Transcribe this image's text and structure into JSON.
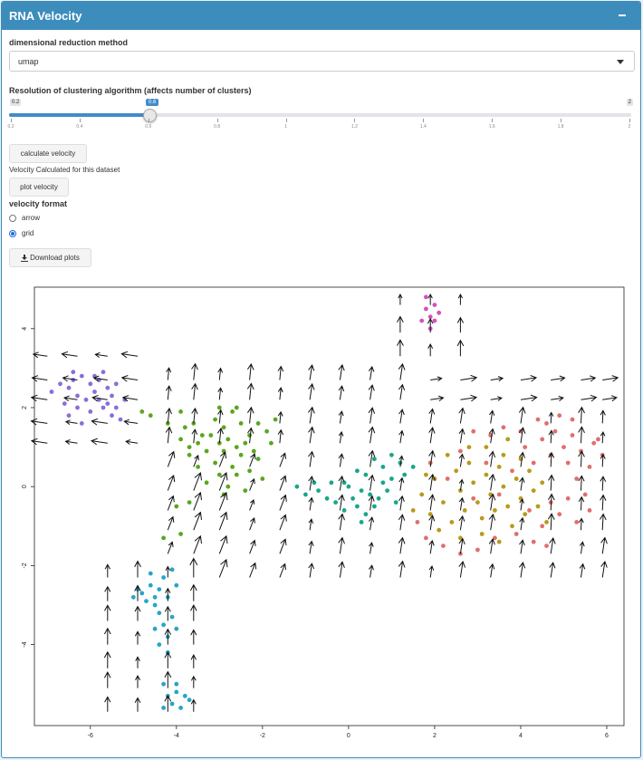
{
  "panel": {
    "title": "RNA Velocity"
  },
  "reduction": {
    "label": "dimensional reduction method",
    "selected": "umap"
  },
  "resolution": {
    "label": "Resolution of clustering algorithm (affects number of clusters)",
    "min_label": "0.2",
    "max_label": "2",
    "value_label": "0.6",
    "min": 0.2,
    "max": 2,
    "value": 0.6,
    "ticks": [
      "0.2",
      "0.4",
      "0.6",
      "0.8",
      "1",
      "1.2",
      "1.4",
      "1.6",
      "1.8",
      "2"
    ]
  },
  "buttons": {
    "calculate": "calculate velocity",
    "plot": "plot velocity",
    "download": "Download plots"
  },
  "status": "Velocity Calculated for this dataset",
  "format": {
    "label": "velocity format",
    "options": [
      {
        "label": "arrow",
        "checked": false
      },
      {
        "label": "grid",
        "checked": true
      }
    ]
  },
  "chart_data": {
    "type": "scatter",
    "title": "",
    "xlabel": "",
    "ylabel": "",
    "xlim": [
      -7.3,
      6.4
    ],
    "ylim": [
      -6.05,
      5.05
    ],
    "x_ticks": [
      -6,
      -4,
      -2,
      0,
      2,
      4,
      6
    ],
    "y_ticks": [
      -4,
      -2,
      0,
      2,
      4
    ],
    "overlay": "velocity grid arrows",
    "colors": [
      "#8b6ddb",
      "#5ba61e",
      "#1aa58a",
      "#b89a1c",
      "#e06f6c",
      "#26a6c4",
      "#d54fbf"
    ],
    "series": [
      {
        "color": "#8b6ddb",
        "points": [
          [
            -6.9,
            2.4
          ],
          [
            -6.7,
            2.6
          ],
          [
            -6.5,
            2.5
          ],
          [
            -6.4,
            2.7
          ],
          [
            -6.3,
            2.3
          ],
          [
            -6.2,
            2.8
          ],
          [
            -6.0,
            2.6
          ],
          [
            -5.9,
            2.4
          ],
          [
            -5.8,
            2.7
          ],
          [
            -5.7,
            2.9
          ],
          [
            -5.6,
            2.5
          ],
          [
            -5.5,
            2.3
          ],
          [
            -5.6,
            2.1
          ],
          [
            -5.8,
            2.2
          ],
          [
            -6.1,
            2.2
          ],
          [
            -6.3,
            2.0
          ],
          [
            -6.5,
            1.8
          ],
          [
            -6.6,
            2.1
          ],
          [
            -6.0,
            1.9
          ],
          [
            -5.7,
            2.0
          ],
          [
            -5.4,
            2.0
          ],
          [
            -5.3,
            1.7
          ],
          [
            -5.2,
            2.2
          ],
          [
            -5.4,
            2.6
          ],
          [
            -6.2,
            1.6
          ],
          [
            -5.9,
            2.8
          ],
          [
            -6.4,
            2.9
          ],
          [
            -5.5,
            1.8
          ]
        ]
      },
      {
        "color": "#5ba61e",
        "points": [
          [
            -4.8,
            1.9
          ],
          [
            -4.6,
            1.8
          ],
          [
            -4.2,
            1.6
          ],
          [
            -3.9,
            1.9
          ],
          [
            -3.6,
            1.6
          ],
          [
            -3.4,
            1.3
          ],
          [
            -3.1,
            1.7
          ],
          [
            -2.9,
            1.5
          ],
          [
            -2.7,
            1.9
          ],
          [
            -2.5,
            1.6
          ],
          [
            -2.3,
            1.3
          ],
          [
            -2.1,
            1.6
          ],
          [
            -1.9,
            1.4
          ],
          [
            -1.8,
            1.1
          ],
          [
            -1.7,
            1.7
          ],
          [
            -3.7,
            0.8
          ],
          [
            -3.5,
            0.5
          ],
          [
            -3.3,
            0.9
          ],
          [
            -3.1,
            0.6
          ],
          [
            -2.9,
            0.9
          ],
          [
            -2.7,
            0.5
          ],
          [
            -2.5,
            0.8
          ],
          [
            -2.3,
            0.4
          ],
          [
            -2.1,
            0.7
          ],
          [
            -2.0,
            0.2
          ],
          [
            -3.9,
            1.2
          ],
          [
            -3.7,
            1.0
          ],
          [
            -3.5,
            1.1
          ],
          [
            -3.2,
            1.3
          ],
          [
            -3.0,
            1.1
          ],
          [
            -2.8,
            1.2
          ],
          [
            -2.6,
            1.0
          ],
          [
            -2.4,
            1.1
          ],
          [
            -2.2,
            0.9
          ],
          [
            -3.0,
            0.3
          ],
          [
            -2.8,
            0.0
          ],
          [
            -2.6,
            0.3
          ],
          [
            -3.3,
            0.1
          ],
          [
            -2.9,
            -0.2
          ],
          [
            -2.4,
            -0.1
          ],
          [
            -3.8,
            1.5
          ],
          [
            -2.6,
            2.0
          ],
          [
            -3.0,
            2.0
          ],
          [
            -4.0,
            -0.5
          ],
          [
            -3.7,
            -0.4
          ],
          [
            -4.3,
            -1.3
          ],
          [
            -3.9,
            -1.2
          ]
        ]
      },
      {
        "color": "#1aa58a",
        "points": [
          [
            -1.2,
            0.0
          ],
          [
            -1.0,
            -0.2
          ],
          [
            -0.8,
            0.1
          ],
          [
            -0.7,
            -0.1
          ],
          [
            -0.5,
            -0.3
          ],
          [
            -0.4,
            0.1
          ],
          [
            -0.3,
            -0.4
          ],
          [
            -0.1,
            -0.6
          ],
          [
            0.0,
            0.0
          ],
          [
            0.1,
            -0.3
          ],
          [
            0.2,
            -0.5
          ],
          [
            0.3,
            -0.1
          ],
          [
            0.4,
            -0.7
          ],
          [
            0.5,
            -0.2
          ],
          [
            0.6,
            -0.5
          ],
          [
            0.7,
            -0.3
          ],
          [
            0.8,
            0.1
          ],
          [
            0.9,
            -0.1
          ],
          [
            1.0,
            0.2
          ],
          [
            1.1,
            -0.4
          ],
          [
            1.2,
            0.6
          ],
          [
            1.0,
            0.8
          ],
          [
            0.8,
            0.5
          ],
          [
            0.6,
            0.7
          ],
          [
            0.4,
            0.3
          ],
          [
            0.2,
            0.4
          ],
          [
            -0.1,
            0.1
          ],
          [
            0.3,
            -0.9
          ],
          [
            1.3,
            0.3
          ],
          [
            1.5,
            0.5
          ]
        ]
      },
      {
        "color": "#b89a1c",
        "points": [
          [
            1.5,
            -0.6
          ],
          [
            1.7,
            -0.2
          ],
          [
            1.9,
            -0.7
          ],
          [
            2.0,
            0.2
          ],
          [
            2.2,
            -0.4
          ],
          [
            2.4,
            -0.9
          ],
          [
            2.5,
            0.4
          ],
          [
            2.6,
            -0.1
          ],
          [
            2.7,
            -0.6
          ],
          [
            2.8,
            0.6
          ],
          [
            2.9,
            0.1
          ],
          [
            3.0,
            -0.4
          ],
          [
            3.1,
            -0.8
          ],
          [
            3.2,
            0.3
          ],
          [
            3.3,
            -0.2
          ],
          [
            3.4,
            -0.6
          ],
          [
            3.5,
            0.5
          ],
          [
            3.6,
            0.0
          ],
          [
            3.7,
            -0.5
          ],
          [
            3.8,
            -1.0
          ],
          [
            3.9,
            0.2
          ],
          [
            4.0,
            -0.3
          ],
          [
            4.1,
            -0.7
          ],
          [
            4.2,
            0.4
          ],
          [
            4.3,
            -0.1
          ],
          [
            4.4,
            -0.5
          ],
          [
            4.5,
            0.1
          ],
          [
            2.3,
            0.8
          ],
          [
            2.8,
            1.0
          ],
          [
            3.2,
            1.0
          ],
          [
            3.6,
            0.8
          ],
          [
            4.0,
            0.7
          ],
          [
            2.1,
            -1.1
          ],
          [
            2.6,
            -1.3
          ],
          [
            3.1,
            -1.2
          ],
          [
            3.5,
            -1.4
          ],
          [
            4.6,
            -0.9
          ],
          [
            1.8,
            0.3
          ],
          [
            3.7,
            1.2
          ]
        ]
      },
      {
        "color": "#e06f6c",
        "points": [
          [
            1.9,
            0.6
          ],
          [
            2.3,
            0.2
          ],
          [
            2.6,
            0.9
          ],
          [
            2.9,
            -0.3
          ],
          [
            3.2,
            0.6
          ],
          [
            3.5,
            -0.2
          ],
          [
            3.8,
            0.4
          ],
          [
            4.1,
            1.0
          ],
          [
            4.3,
            0.6
          ],
          [
            4.5,
            1.2
          ],
          [
            4.7,
            0.8
          ],
          [
            4.8,
            1.4
          ],
          [
            5.0,
            1.0
          ],
          [
            5.1,
            0.6
          ],
          [
            5.2,
            1.3
          ],
          [
            5.3,
            0.2
          ],
          [
            5.4,
            0.9
          ],
          [
            5.5,
            -0.2
          ],
          [
            5.6,
            0.5
          ],
          [
            5.7,
            1.1
          ],
          [
            5.8,
            1.2
          ],
          [
            5.9,
            0.8
          ],
          [
            4.6,
            1.6
          ],
          [
            4.9,
            1.8
          ],
          [
            5.2,
            1.7
          ],
          [
            4.4,
            1.7
          ],
          [
            4.2,
            -0.6
          ],
          [
            4.5,
            -1.0
          ],
          [
            4.7,
            -0.4
          ],
          [
            4.9,
            -0.7
          ],
          [
            5.1,
            -0.3
          ],
          [
            3.9,
            -1.2
          ],
          [
            4.3,
            -1.4
          ],
          [
            4.6,
            -1.5
          ],
          [
            3.4,
            -1.3
          ],
          [
            3.0,
            -1.6
          ],
          [
            2.6,
            -1.7
          ],
          [
            2.2,
            -1.5
          ],
          [
            1.8,
            -1.3
          ],
          [
            1.6,
            -0.9
          ],
          [
            3.6,
            1.5
          ],
          [
            3.3,
            1.3
          ],
          [
            2.9,
            1.4
          ],
          [
            5.6,
            -0.6
          ],
          [
            5.3,
            -0.9
          ],
          [
            4.0,
            1.4
          ]
        ]
      },
      {
        "color": "#26a6c4",
        "points": [
          [
            -5.0,
            -2.8
          ],
          [
            -4.9,
            -2.6
          ],
          [
            -4.7,
            -2.9
          ],
          [
            -4.6,
            -2.5
          ],
          [
            -4.5,
            -3.0
          ],
          [
            -4.4,
            -2.6
          ],
          [
            -4.3,
            -2.3
          ],
          [
            -4.2,
            -2.8
          ],
          [
            -4.1,
            -2.1
          ],
          [
            -4.0,
            -2.5
          ],
          [
            -4.4,
            -3.2
          ],
          [
            -4.3,
            -3.5
          ],
          [
            -4.2,
            -3.8
          ],
          [
            -4.1,
            -3.3
          ],
          [
            -4.0,
            -3.6
          ],
          [
            -4.5,
            -3.6
          ],
          [
            -4.4,
            -4.0
          ],
          [
            -4.2,
            -4.2
          ],
          [
            -4.3,
            -5.0
          ],
          [
            -4.2,
            -5.3
          ],
          [
            -4.1,
            -5.5
          ],
          [
            -4.0,
            -5.2
          ],
          [
            -3.9,
            -5.6
          ],
          [
            -3.8,
            -5.3
          ],
          [
            -4.3,
            -5.6
          ],
          [
            -4.0,
            -5.0
          ],
          [
            -3.7,
            -5.4
          ],
          [
            -4.6,
            -2.2
          ],
          [
            -4.8,
            -2.7
          ],
          [
            -4.5,
            -2.8
          ]
        ]
      },
      {
        "color": "#d54fbf",
        "points": [
          [
            1.7,
            4.2
          ],
          [
            1.8,
            4.5
          ],
          [
            1.9,
            4.3
          ],
          [
            2.0,
            4.6
          ],
          [
            1.9,
            4.0
          ],
          [
            1.8,
            4.8
          ],
          [
            2.0,
            4.2
          ],
          [
            2.1,
            4.4
          ]
        ]
      }
    ]
  }
}
